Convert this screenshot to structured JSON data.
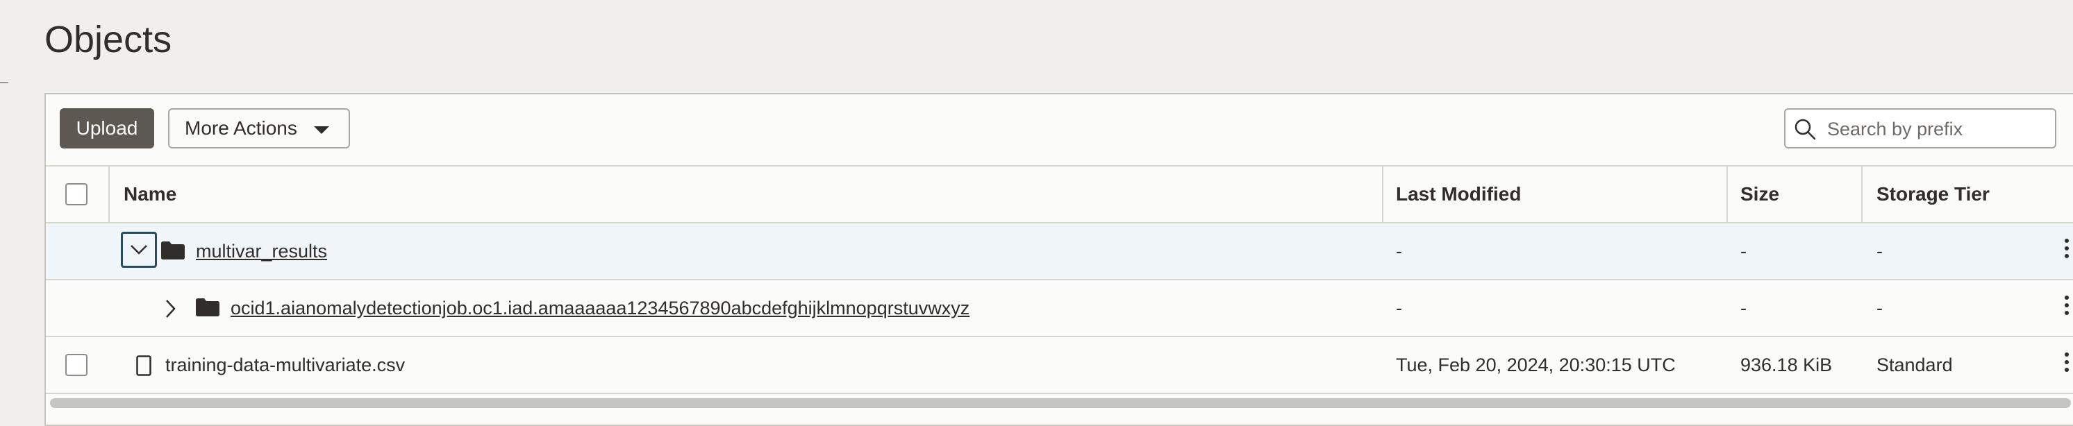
{
  "page": {
    "title": "Objects"
  },
  "toolbar": {
    "upload_label": "Upload",
    "more_actions_label": "More Actions",
    "search_placeholder": "Search by prefix",
    "search_value": ""
  },
  "table": {
    "columns": [
      "Name",
      "Last Modified",
      "Size",
      "Storage Tier"
    ],
    "rows": [
      {
        "name": "multivar_results",
        "type": "folder",
        "expanded": true,
        "last_modified": "-",
        "size": "-",
        "storage_tier": "-"
      },
      {
        "name": "ocid1.aianomalydetectionjob.oc1.iad.amaaaaaa1234567890abcdefghijklmnopqrstuvwxyz",
        "type": "folder",
        "expanded": false,
        "last_modified": "-",
        "size": "-",
        "storage_tier": "-"
      },
      {
        "name": "training-data-multivariate.csv",
        "type": "file",
        "last_modified": "Tue, Feb 20, 2024, 20:30:15 UTC",
        "size": "936.18 KiB",
        "storage_tier": "Standard"
      }
    ]
  },
  "colors": {
    "primary_button": "#5e5853",
    "selected_row": "#eff5f9",
    "focus_border": "#2c4a5d"
  }
}
